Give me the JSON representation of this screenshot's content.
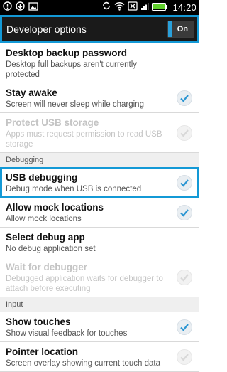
{
  "status_bar": {
    "time": "14:20"
  },
  "header": {
    "title": "Developer options",
    "toggle_label": "On"
  },
  "items": [
    {
      "title": "Desktop backup password",
      "summary": "Desktop full backups aren't currently protected"
    },
    {
      "title": "Stay awake",
      "summary": "Screen will never sleep while charging",
      "checked": true
    },
    {
      "title": "Protect USB storage",
      "summary": "Apps must request permission to read USB storage",
      "disabled": true
    },
    {
      "section": "Debugging"
    },
    {
      "title": "USB debugging",
      "summary": "Debug mode when USB is connected",
      "checked": true
    },
    {
      "title": "Allow mock locations",
      "summary": "Allow mock locations",
      "checked": true
    },
    {
      "title": "Select debug app",
      "summary": "No debug application set"
    },
    {
      "title": "Wait for debugger",
      "summary": "Debugged application waits for debugger to attach before executing",
      "disabled": true
    },
    {
      "section": "Input"
    },
    {
      "title": "Show touches",
      "summary": "Show visual feedback for touches",
      "checked": true
    },
    {
      "title": "Pointer location",
      "summary": "Screen overlay showing current touch data"
    }
  ],
  "accent_color": "#1399d6"
}
